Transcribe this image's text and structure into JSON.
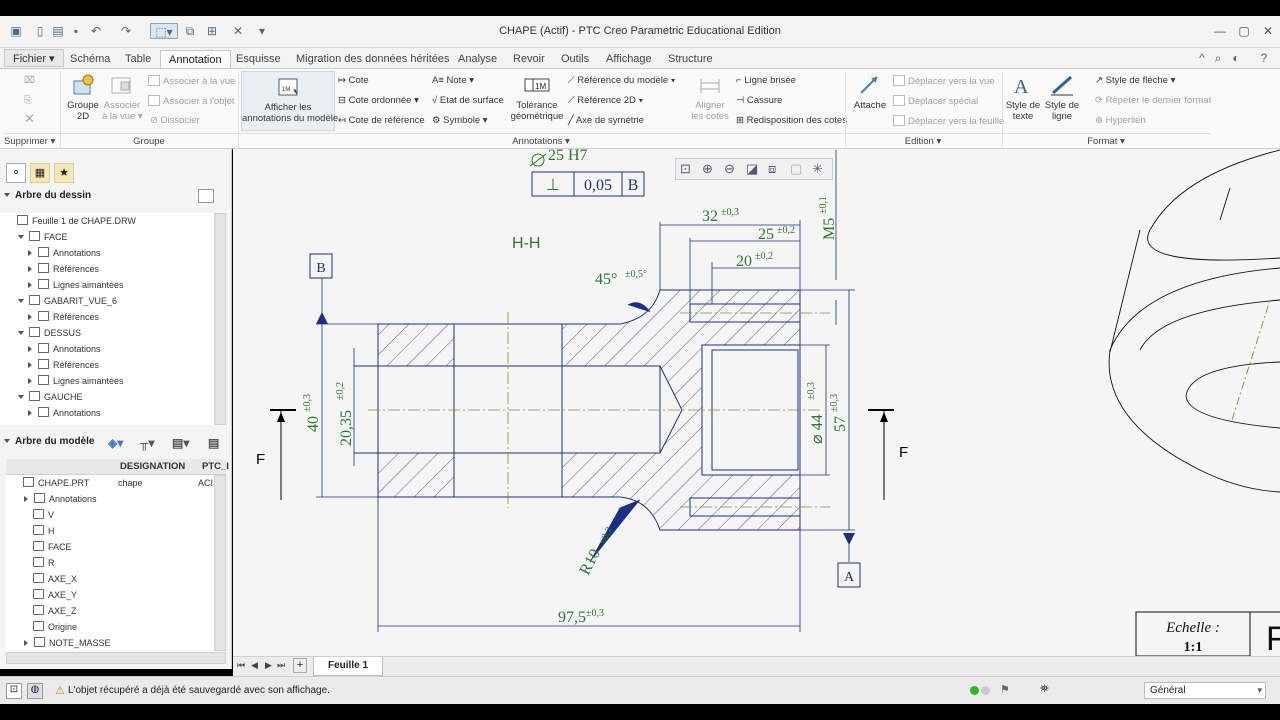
{
  "window": {
    "title": "CHAPE (Actif) - PTC Creo Parametric Educational Edition"
  },
  "tabs": {
    "fichier": "Fichier ▾",
    "items": [
      "Schéma",
      "Table",
      "Annotation",
      "Esquisse",
      "Migration des données héritées",
      "Analyse",
      "Revoir",
      "Outils",
      "Affichage",
      "Structure"
    ]
  },
  "ribbon": {
    "supprimer": "Supprimer ▾",
    "groupe_label": "Groupe",
    "groupe2d": "Groupe\n2D",
    "associer_vue": "Associer\nà la vue ▾",
    "associer_a_la_vue": "Associer à la vue",
    "associer_a_lobjet": "Associer à l'objet",
    "dissocier": "Dissocier",
    "afficher_annotations": "Afficher les\nannotations du modèle",
    "cote": "Cote",
    "cote_ordonnee": "Cote ordonnée ▾",
    "cote_reference": "Cote de référence",
    "note": "Note ▾",
    "etat_surface": "Etat de surface",
    "symbole": "Symbole ▾",
    "tolerance_geo": "Tolérance\ngéométrique",
    "ref_modele": "Référence du modèle ▾",
    "ref_2d": "Référence 2D ▾",
    "axe_symetrie": "Axe de symétrie",
    "aligner_cotes": "Aligner\nles cotes",
    "ligne_brisee": "Ligne brisée",
    "cassure": "Cassure",
    "redisposition": "Redisposition des cotes",
    "annotations_label": "Annotations ▾",
    "attache": "Attache",
    "deplacer_vue": "Déplacer vers la vue",
    "deplacer_special": "Déplacer spécial",
    "deplacer_feuille": "Déplacer vers la feuille",
    "edition_label": "Edition ▾",
    "style_texte": "Style de\ntexte",
    "style_ligne": "Style de\nligne",
    "style_fleche": "Style de flèche ▾",
    "repeter_format": "Répéter le dernier format",
    "hyperlien": "Hyperlien",
    "format_label": "Format ▾"
  },
  "left_panel": {
    "arbre_dessin": "Arbre du dessin",
    "dessin_items": [
      {
        "label": "Feuille 1 de CHAPE.DRW",
        "level": 0,
        "exp": ""
      },
      {
        "label": "FACE",
        "level": 1,
        "exp": "down"
      },
      {
        "label": "Annotations",
        "level": 2,
        "exp": "right"
      },
      {
        "label": "Références",
        "level": 2,
        "exp": "right"
      },
      {
        "label": "Lignes aimantées",
        "level": 2,
        "exp": "right"
      },
      {
        "label": "GABARIT_VUE_6",
        "level": 1,
        "exp": "down"
      },
      {
        "label": "Références",
        "level": 2,
        "exp": "right"
      },
      {
        "label": "DESSUS",
        "level": 1,
        "exp": "down"
      },
      {
        "label": "Annotations",
        "level": 2,
        "exp": "right"
      },
      {
        "label": "Références",
        "level": 2,
        "exp": "right"
      },
      {
        "label": "Lignes aimantées",
        "level": 2,
        "exp": "right"
      },
      {
        "label": "GAUCHE",
        "level": 1,
        "exp": "down"
      },
      {
        "label": "Annotations",
        "level": 2,
        "exp": "right"
      }
    ],
    "arbre_modele": "Arbre du modèle",
    "col_designation": "DESIGNATION",
    "col_ptc": "PTC_I",
    "model_items": [
      {
        "label": "CHAPE.PRT",
        "level": 0,
        "desig": "chape",
        "ptc": "ACI"
      },
      {
        "label": "Annotations",
        "level": 1,
        "exp": "right"
      },
      {
        "label": "V",
        "level": 1
      },
      {
        "label": "H",
        "level": 1
      },
      {
        "label": "FACE",
        "level": 1
      },
      {
        "label": "R",
        "level": 1
      },
      {
        "label": "AXE_X",
        "level": 1
      },
      {
        "label": "AXE_Y",
        "level": 1
      },
      {
        "label": "AXE_Z",
        "level": 1
      },
      {
        "label": "Origine",
        "level": 1
      },
      {
        "label": "NOTE_MASSE",
        "level": 1,
        "exp": "right"
      }
    ]
  },
  "drawing": {
    "section_label": "H-H",
    "tol_frame": {
      "symbol": "⊥",
      "value": "0,05",
      "datum": "B"
    },
    "top_fit": "25 H7",
    "dims": {
      "d32": "32",
      "t32": "±0,3",
      "d25": "25",
      "t25": "±0,2",
      "d20": "20",
      "t20": "±0,2",
      "m5": "M5",
      "tm5": "±0,1",
      "a45": "45°",
      "ta45": "±0,5°",
      "d40": "40",
      "t40": "±0,3",
      "d2035": "20,35",
      "t2035": "±0,2",
      "d44": "⌀ 44",
      "t44": "±0,3",
      "d57": "57",
      "t57": "±0,3",
      "r10": "R10",
      "tr10": "±0,2",
      "d975": "97,5",
      "t975": "±0,3"
    },
    "datum_b": "B",
    "datum_a": "A",
    "section_f": "F",
    "echelle_label": "Echelle :",
    "echelle_value": "1:1",
    "title_cut": "F"
  },
  "sheet": {
    "tab": "Feuille 1"
  },
  "status": {
    "message": "L'objet récupéré a déjà été sauvegardé avec son affichage.",
    "filter": "Général"
  },
  "colors": {
    "dim_green": "#2a7a2a",
    "line_blue": "#1c2f86",
    "axis_olive": "#8a8a2a"
  }
}
